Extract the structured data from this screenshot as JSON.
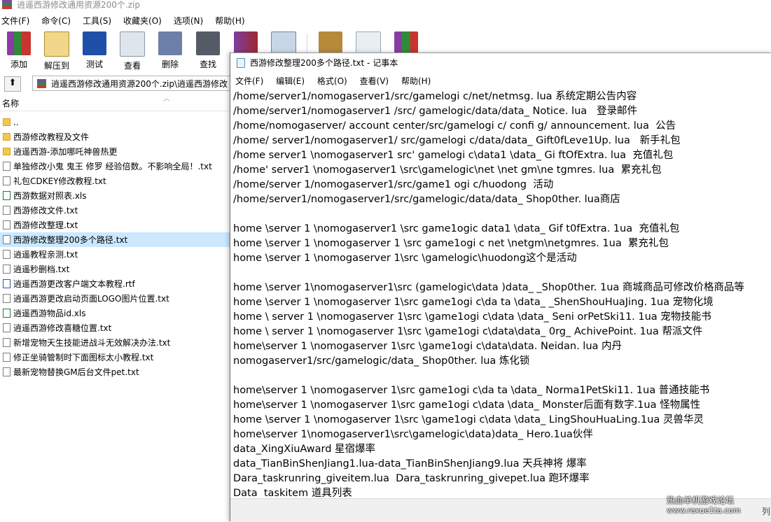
{
  "winrar": {
    "title": "逍遥西游修改通用资源200个.zip",
    "menu": [
      "文件(F)",
      "命令(C)",
      "工具(S)",
      "收藏夹(O)",
      "选项(N)",
      "帮助(H)"
    ],
    "toolbar": [
      {
        "label": "添加",
        "icon": "add-archive-icon"
      },
      {
        "label": "解压到",
        "icon": "extract-icon"
      },
      {
        "label": "测试",
        "icon": "test-icon"
      },
      {
        "label": "查看",
        "icon": "view-icon"
      },
      {
        "label": "删除",
        "icon": "delete-icon"
      },
      {
        "label": "查找",
        "icon": "find-icon"
      },
      {
        "label": "",
        "icon": "wizard-icon"
      },
      {
        "label": "",
        "icon": "info-icon"
      },
      {
        "label": "",
        "icon": "virus-scan-icon"
      },
      {
        "label": "",
        "icon": "comment-icon"
      },
      {
        "label": "",
        "icon": "sfx-icon"
      }
    ],
    "address": "逍遥西游修改通用资源200个.zip\\逍遥西游修改",
    "column_name": "名称",
    "files": [
      {
        "name": "..",
        "type": "folder"
      },
      {
        "name": "西游修改教程及文件",
        "type": "folder"
      },
      {
        "name": "逍遥西游-添加哪吒神兽热更",
        "type": "folder"
      },
      {
        "name": "单独修改小鬼 鬼王 修罗 经验倍数。不影响全局！.txt",
        "type": "txt"
      },
      {
        "name": "礼包CDKEY修改教程.txt",
        "type": "txt"
      },
      {
        "name": "西游数据对照表.xls",
        "type": "xls"
      },
      {
        "name": "西游修改文件.txt",
        "type": "txt"
      },
      {
        "name": "西游修改整理.txt",
        "type": "txt"
      },
      {
        "name": "西游修改整理200多个路径.txt",
        "type": "txt",
        "selected": true
      },
      {
        "name": "逍遥教程亲测.txt",
        "type": "txt"
      },
      {
        "name": "逍遥秒删档.txt",
        "type": "txt"
      },
      {
        "name": "逍遥西游更改客户端文本教程.rtf",
        "type": "rtf"
      },
      {
        "name": "逍遥西游更改启动页面LOGO图片位置.txt",
        "type": "txt"
      },
      {
        "name": "逍遥西游物品id.xls",
        "type": "xls"
      },
      {
        "name": "逍遥西游修改喜糖位置.txt",
        "type": "txt"
      },
      {
        "name": "新增宠物天生技能进战斗无效解决办法.txt",
        "type": "txt"
      },
      {
        "name": "修正坐骑管制时下面图标太小教程.txt",
        "type": "txt"
      },
      {
        "name": "最新宠物替换GM后台文件pet.txt",
        "type": "txt"
      }
    ]
  },
  "notepad": {
    "title": "西游修改整理200多个路径.txt - 记事本",
    "menu": [
      "文件(F)",
      "编辑(E)",
      "格式(O)",
      "查看(V)",
      "帮助(H)"
    ],
    "lines": [
      "/home/server1/nomogaserver1/src/gamelogi c/net/netmsg. lua 系统定期公告内容",
      "/home/server1/nomogaserver1 /src/ gamelogic/data/data_ Notice. lua   登录邮件",
      "/home/nomogaserver/ account center/src/gamelogi c/ confi g/ announcement. lua  公告",
      "/home/ server1/nomogaserver1/ src/gamelogi c/data/data_ Gift0fLeve1Up. lua   新手礼包",
      "/home server1 \\nomogaserver1 src' gamelogi c\\data1 \\data_ Gi ftOfExtra. lua  充值礼包",
      "/home' server1 \\nomogaserver1 \\src\\gamelogic\\net \\net gm\\ne tgmres. lua  累充礼包",
      "/home/server 1/nomogaserver1/src/game1 ogi c/huodong  活动",
      "/home/server1/nomogaserver1/src/gamelogic/data/data_ Shop0ther. lua商店",
      "",
      "home \\server 1 \\nomogaserver1 \\src game1ogic data1 \\data_ Gif t0fExtra. 1ua  充值礼包",
      "home \\server 1 \\nomogaserver 1 \\src game1ogi c net \\netgm\\netgmres. 1ua  累充礼包",
      "home \\server 1 \\nomogaserver 1\\src \\gamelogic\\huodong这个是活动",
      "",
      "home \\server 1\\nomogaserver1\\src (gamelogic\\data )data_ _Shop0ther. 1ua 商城商品可修改价格商品等",
      "home \\server 1 \\nomogaserver 1\\src game1ogi c\\da ta \\data_ _ShenShouHuaJing. 1ua 宠物化境",
      "home \\ server 1 \\nomogaserver 1\\src \\game1ogi c\\data \\data_ Seni orPetSki11. 1ua 宠物技能书",
      "home \\ server 1 \\nomogaserver 1\\src \\game1ogi c\\data\\data_ 0rg_ AchivePoint. 1ua 帮派文件",
      "home\\server 1 \\nomogaserver 1\\src \\game1ogi c\\data\\data. Neidan. lua 内丹",
      "nomogaserver1/src/gamelogic/data_ Shop0ther. lua 炼化锁",
      "",
      "home\\server 1 \\nomogaserver 1\\src game1ogi c\\da ta \\data_ Norma1PetSki11. 1ua 普通技能书",
      "home\\server 1 \\nomogaserver 1\\src game1ogi c\\data \\data_ Monster后面有数字.1ua 怪物属性",
      "home \\server 1 \\nomogaserver 1\\src \\game1ogi c\\data \\data_ LingShouHuaLing.1ua 灵兽华灵",
      "home\\server 1\\nomogaserver1\\src\\gamelogic\\data)data_ Hero.1ua伙伴",
      "data_XingXiuAward 星宿爆率",
      "data_TianBinShenJiang1.lua-data_TianBinShenJiang9.lua 天兵神将 爆率",
      "Dara_taskrunring_giveitem.lua  Dara_taskrunring_givepet.lua 跑环爆率",
      "Data  taskitem 道具列表"
    ],
    "status_right": "列"
  },
  "watermark": {
    "line1": "热血单机游戏论坛",
    "line2": "www.rexue1ta.com"
  }
}
